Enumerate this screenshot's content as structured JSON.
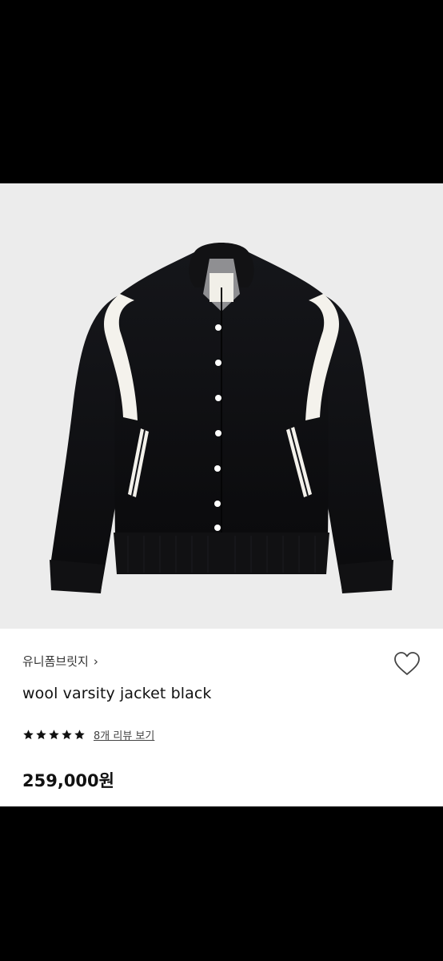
{
  "product": {
    "brand": "유니폼브릿지",
    "brand_chevron": "›",
    "title": "wool varsity jacket black",
    "rating": {
      "stars": 5,
      "review_link": "8개 리뷰 보기"
    },
    "price": "259,000원"
  },
  "icons": {
    "heart": "heart-outline-icon",
    "star": "star-filled-icon",
    "chevron": "chevron-right-icon"
  },
  "colors": {
    "image_background": "#ececec",
    "jacket_body": "#0f0f10",
    "jacket_accent": "#f4f2ec"
  }
}
